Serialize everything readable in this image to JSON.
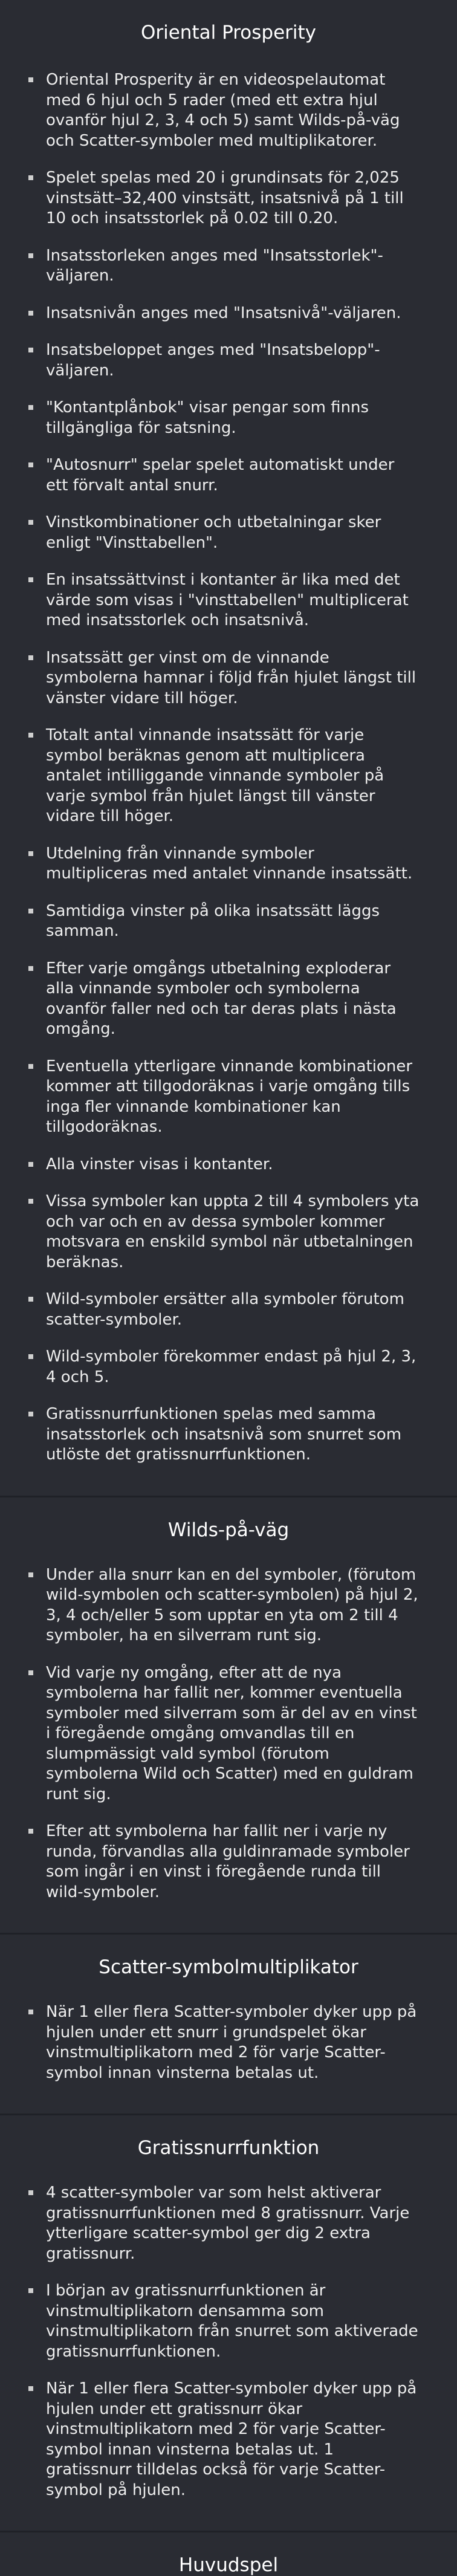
{
  "sections": [
    {
      "title": "Oriental Prosperity",
      "items": [
        "Oriental Prosperity är en videospelautomat med 6 hjul och 5 rader (med ett extra hjul ovanför hjul 2, 3, 4 och 5) samt Wilds-på-väg och Scatter-symboler med multiplikatorer.",
        "Spelet spelas med 20 i grundinsats för 2,025 vinstsätt–32,400 vinstsätt, insatsnivå på 1 till 10 och insatsstorlek på 0.02 till 0.20.",
        "Insatsstorleken anges med \"Insatsstorlek\"-väljaren.",
        "Insatsnivån anges med \"Insatsnivå\"-väljaren.",
        "Insatsbeloppet anges med \"Insatsbelopp\"-väljaren.",
        "\"Kontantplånbok\" visar pengar som finns tillgängliga för satsning.",
        "\"Autosnurr\" spelar spelet automatiskt under ett förvalt antal snurr.",
        "Vinstkombinationer och utbetalningar sker enligt \"Vinsttabellen\".",
        "En insatssättvinst i kontanter är lika med det värde som visas i \"vinsttabellen\" multiplicerat med insatsstorlek och insatsnivå.",
        "Insatssätt ger vinst om de vinnande symbolerna hamnar i följd från hjulet längst till vänster vidare till höger.",
        "Totalt antal vinnande insatssätt för varje symbol beräknas genom att multiplicera antalet intilliggande vinnande symboler på varje symbol från hjulet längst till vänster vidare till höger.",
        "Utdelning från vinnande symboler multipliceras med antalet vinnande insatssätt.",
        "Samtidiga vinster på olika insatssätt läggs samman.",
        "Efter varje omgångs utbetalning exploderar alla vinnande symboler och symbolerna ovanför faller ned och tar deras plats i nästa omgång.",
        "Eventuella ytterligare vinnande kombinationer kommer att tillgodoräknas i varje omgång tills inga fler vinnande kombinationer kan tillgodoräknas.",
        "Alla vinster visas i kontanter.",
        "Vissa symboler kan uppta 2 till 4 symbolers yta och var och en av dessa symboler kommer motsvara en enskild symbol när utbetalningen beräknas.",
        "Wild-symboler ersätter alla symboler förutom scatter-symboler.",
        "Wild-symboler förekommer endast på hjul 2, 3, 4 och 5.",
        "Gratissnurrfunktionen spelas med samma insatsstorlek och insatsnivå som snurret som utlöste det gratissnurrfunktionen."
      ]
    },
    {
      "title": "Wilds-på-väg",
      "items": [
        "Under alla snurr kan en del symboler, (förutom wild-symbolen och scatter-symbolen) på hjul 2, 3, 4 och/eller 5 som upptar en yta om 2 till 4 symboler, ha en silverram runt sig.",
        "Vid varje ny omgång, efter att de nya symbolerna har fallit ner, kommer eventuella symboler med silverram som är del av en vinst i föregående omgång omvandlas till en slumpmässigt vald symbol (förutom symbolerna Wild och Scatter) med en guldram runt sig.",
        "Efter att symbolerna har fallit ner i varje ny runda, förvandlas alla guldinramade symboler som ingår i en vinst i föregående runda till wild-symboler."
      ]
    },
    {
      "title": "Scatter-symbolmultiplikator",
      "items": [
        "När 1 eller flera Scatter-symboler dyker upp på hjulen under ett snurr i grundspelet ökar vinstmultiplikatorn med 2 för varje Scatter-symbol innan vinsterna betalas ut."
      ]
    },
    {
      "title": "Gratissnurrfunktion",
      "items": [
        "4 scatter-symboler var som helst aktiverar gratissnurrfunktionen med 8 gratissnurr. Varje ytterligare scatter-symbol ger dig 2 extra gratissnurr.",
        "I början av gratissnurrfunktionen är vinstmultiplikatorn densamma som vinstmultiplikatorn från snurret som aktiverade gratissnurrfunktionen.",
        "När 1 eller flera Scatter-symboler dyker upp på hjulen under ett gratissnurr ökar vinstmultiplikatorn med 2 för varje Scatter-symbol innan vinsterna betalas ut. 1 gratissnurr tilldelas också för varje Scatter-symbol på hjulen."
      ]
    },
    {
      "title": "Huvudspel",
      "items": []
    }
  ]
}
